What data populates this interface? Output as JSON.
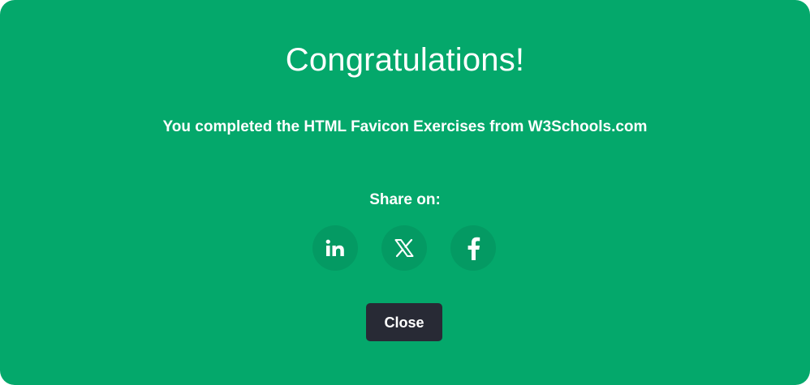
{
  "modal": {
    "title": "Congratulations!",
    "message": "You completed the HTML Favicon Exercises from W3Schools.com",
    "share_label": "Share on:",
    "share_buttons": [
      {
        "icon": "linkedin-icon"
      },
      {
        "icon": "x-icon"
      },
      {
        "icon": "facebook-icon"
      }
    ],
    "close_label": "Close"
  },
  "colors": {
    "modal_background": "#04a86b",
    "share_button_background": "#049a63",
    "close_button_background": "#282a35",
    "text": "#ffffff"
  }
}
